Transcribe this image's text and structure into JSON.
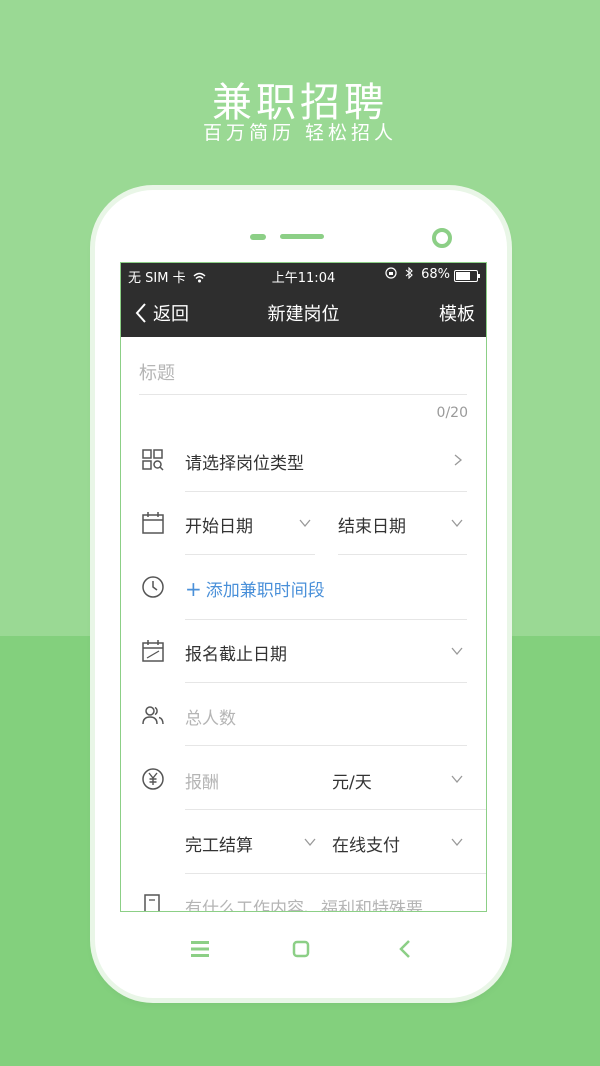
{
  "hero": {
    "title": "兼职招聘",
    "subtitle": "百万简历 轻松招人"
  },
  "status": {
    "carrier": "无 SIM 卡",
    "time": "上午11:04",
    "battery": "68%",
    "battery_level": 0.68
  },
  "navbar": {
    "back_label": "返回",
    "title": "新建岗位",
    "right_label": "模板"
  },
  "form": {
    "title_placeholder": "标题",
    "title_counter": "0/20",
    "job_type": "请选择岗位类型",
    "start_date": "开始日期",
    "end_date": "结束日期",
    "add_time": "添加兼职时间段",
    "deadline": "报名截止日期",
    "headcount_placeholder": "总人数",
    "pay_placeholder": "报酬",
    "pay_unit": "元/天",
    "settlement": "完工结算",
    "payment": "在线支付",
    "description_placeholder": "有什么工作内容、福利和特殊要"
  },
  "colors": {
    "bg_top": "#9ad994",
    "bg_bottom": "#83d07d",
    "accent": "#8ccf86",
    "link": "#4a90d9",
    "navbar": "#2e2e2e"
  }
}
